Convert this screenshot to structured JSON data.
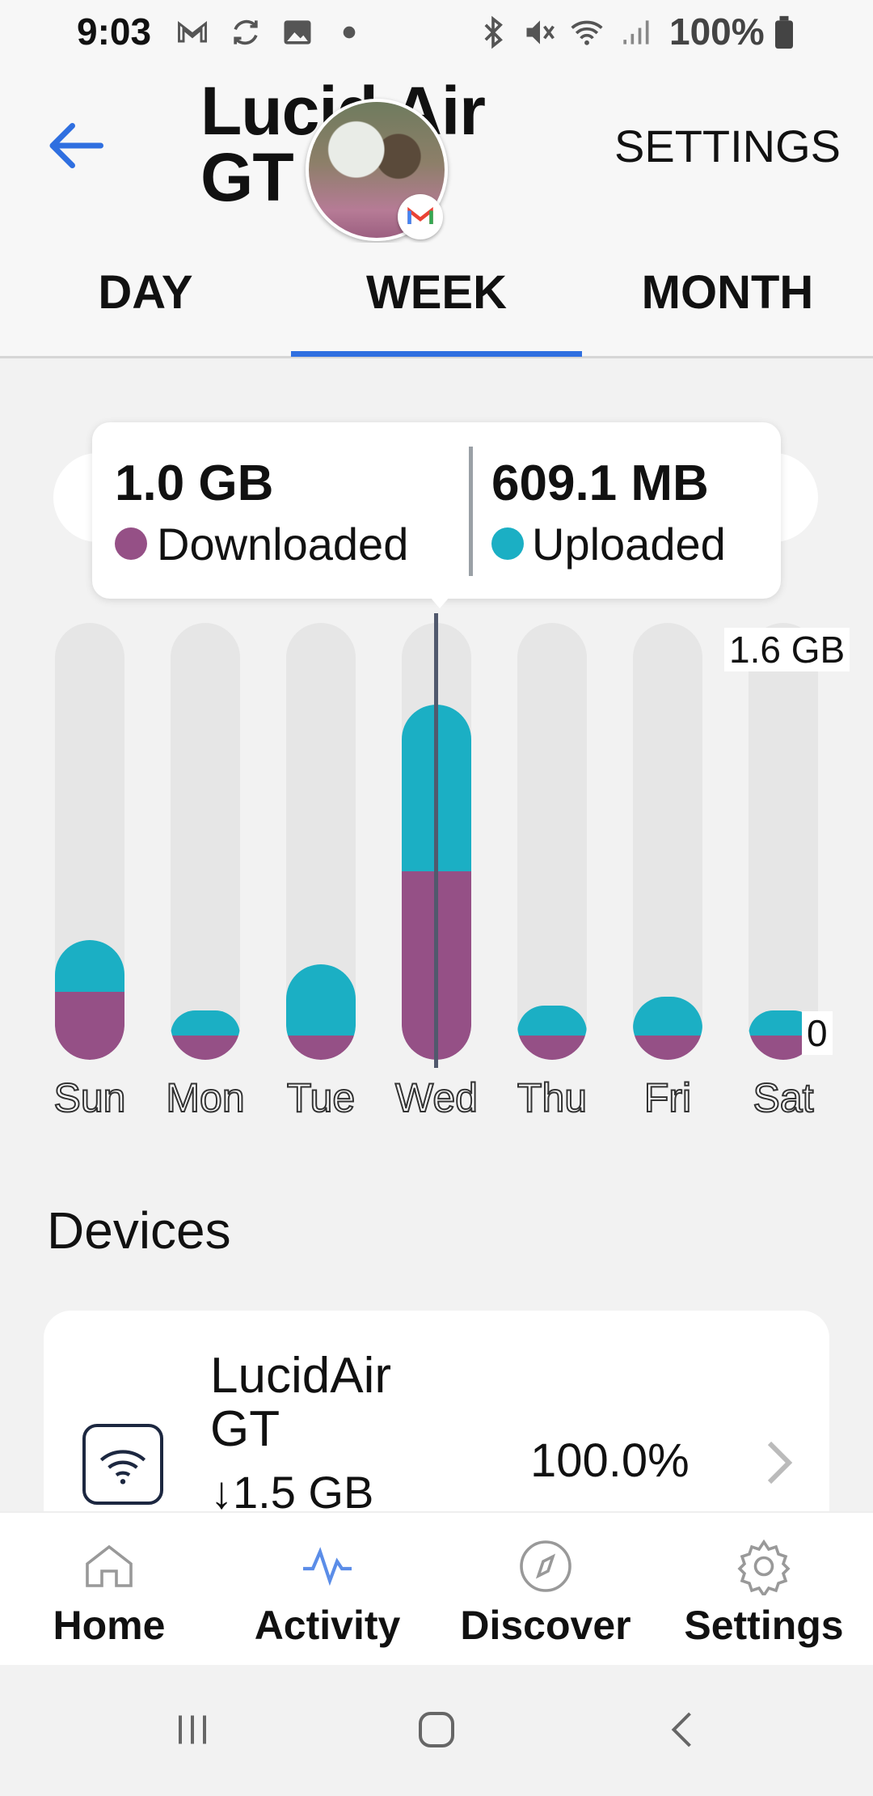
{
  "status_bar": {
    "time": "9:03",
    "battery": "100%",
    "icons": [
      "gmail-icon",
      "sync-icon",
      "image-icon",
      "dot-icon",
      "bluetooth-icon",
      "mute-icon",
      "wifi-icon",
      "signal-icon",
      "battery-icon"
    ]
  },
  "header": {
    "back_icon": "arrow-left-icon",
    "title": "Lucid Air GT",
    "settings_label": "SETTINGS"
  },
  "tabs": [
    {
      "label": "DAY",
      "active": false
    },
    {
      "label": "WEEK",
      "active": true
    },
    {
      "label": "MONTH",
      "active": false
    }
  ],
  "tooltip": {
    "downloaded_value": "1.0 GB",
    "downloaded_label": "Downloaded",
    "uploaded_value": "609.1 MB",
    "uploaded_label": "Uploaded"
  },
  "colors": {
    "downloaded": "#955086",
    "uploaded": "#1bafc4",
    "accent": "#2f6fe0"
  },
  "chart_data": {
    "type": "bar",
    "stacked": true,
    "categories": [
      "Sun",
      "Mon",
      "Tue",
      "Wed",
      "Thu",
      "Fri",
      "Sat"
    ],
    "series": [
      {
        "name": "Downloaded",
        "values": [
          0.25,
          0.09,
          0.09,
          0.69,
          0.09,
          0.09,
          0.09
        ]
      },
      {
        "name": "Uploaded",
        "values": [
          0.19,
          0.09,
          0.26,
          0.61,
          0.11,
          0.14,
          0.09
        ]
      }
    ],
    "ylim": [
      0,
      1.6
    ],
    "y_max_label": "1.6 GB",
    "y_min_label": "0",
    "selected": "Wed"
  },
  "devices": {
    "heading": "Devices",
    "items": [
      {
        "name": "LucidAir GT",
        "usage": "↓1.5 GB",
        "percent": "100.0%"
      }
    ]
  },
  "bottom_nav": [
    {
      "label": "Home",
      "icon": "home-icon"
    },
    {
      "label": "Activity",
      "icon": "activity-icon",
      "active": true
    },
    {
      "label": "Discover",
      "icon": "compass-icon"
    },
    {
      "label": "Settings",
      "icon": "gear-icon"
    }
  ]
}
